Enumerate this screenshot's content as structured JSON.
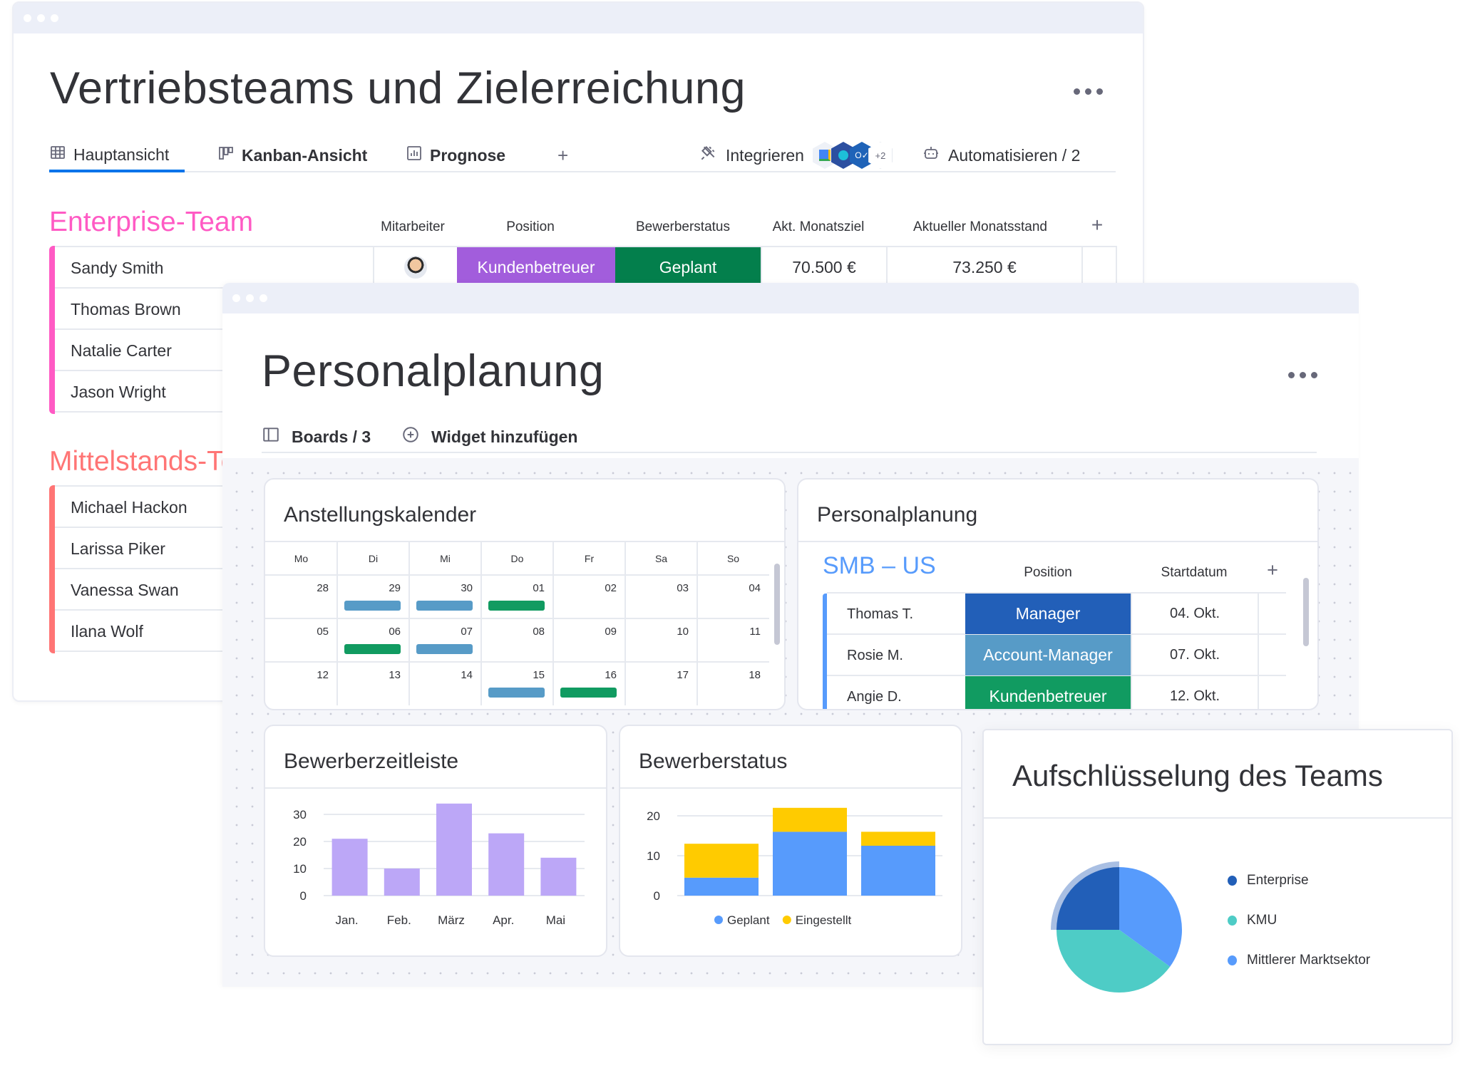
{
  "window1": {
    "title": "Vertriebsteams und Zielerreichung",
    "tabs": [
      {
        "label": "Hauptansicht",
        "icon": "table-icon",
        "active": true
      },
      {
        "label": "Kanban-Ansicht",
        "icon": "kanban-icon",
        "active": false
      },
      {
        "label": "Prognose",
        "icon": "chart-icon",
        "active": false
      }
    ],
    "add_tab_label": "+",
    "integrate_label": "Integrieren",
    "integrations_more": "+2",
    "automate_label": "Automatisieren / 2",
    "columns": [
      "Mitarbeiter",
      "Position",
      "Bewerberstatus",
      "Akt. Monatsziel",
      "Aktueller Monatsstand"
    ],
    "add_column_label": "+",
    "groups": [
      {
        "title": "Enterprise-Team",
        "color": "#ff5ac4",
        "rows": [
          {
            "name": "Sandy Smith",
            "position": "Kundenbetreuer",
            "position_color": "#a25ddc",
            "status": "Geplant",
            "status_color": "#037f4c",
            "goal": "70.500 €",
            "current": "73.250 €"
          },
          {
            "name": "Thomas Brown"
          },
          {
            "name": "Natalie Carter"
          },
          {
            "name": "Jason Wright"
          }
        ]
      },
      {
        "title": "Mittelstands-Team",
        "color": "#ff7575",
        "rows": [
          {
            "name": "Michael Hackon"
          },
          {
            "name": "Larissa Piker"
          },
          {
            "name": "Vanessa Swan"
          },
          {
            "name": "Ilana Wolf"
          }
        ]
      }
    ]
  },
  "window2": {
    "title": "Personalplanung",
    "boards_label": "Boards / 3",
    "add_widget_label": "Widget hinzufügen",
    "calendar": {
      "title": "Anstellungskalender",
      "weekdays": [
        "Mo",
        "Di",
        "Mi",
        "Do",
        "Fr",
        "Sa",
        "So"
      ],
      "weeks": [
        [
          "28",
          "29",
          "30",
          "01",
          "02",
          "03",
          "04"
        ],
        [
          "05",
          "06",
          "07",
          "08",
          "09",
          "10",
          "11"
        ],
        [
          "12",
          "13",
          "14",
          "15",
          "16",
          "17",
          "18"
        ]
      ],
      "events": [
        {
          "week": 0,
          "day": 1,
          "color": "#579bc7"
        },
        {
          "week": 0,
          "day": 2,
          "color": "#579bc7"
        },
        {
          "week": 0,
          "day": 3,
          "color": "#119b61"
        },
        {
          "week": 1,
          "day": 1,
          "color": "#119b61"
        },
        {
          "week": 1,
          "day": 2,
          "color": "#579bc7"
        },
        {
          "week": 2,
          "day": 3,
          "color": "#579bc7"
        },
        {
          "week": 2,
          "day": 4,
          "color": "#119b61"
        }
      ]
    },
    "staffing": {
      "title": "Personalplanung",
      "group_title": "SMB – US",
      "group_color": "#579bfc",
      "columns": [
        "Position",
        "Startdatum"
      ],
      "add_column_label": "+",
      "rows": [
        {
          "name": "Thomas T.",
          "position": "Manager",
          "position_color": "#225fb8",
          "date": "04. Okt."
        },
        {
          "name": "Rosie M.",
          "position": "Account-Manager",
          "position_color": "#579bc7",
          "date": "07. Okt."
        },
        {
          "name": "Angie D.",
          "position": "Kundenbetreuer",
          "position_color": "#119b61",
          "date": "12. Okt."
        }
      ]
    }
  },
  "chart_data": [
    {
      "type": "bar",
      "title": "Bewerberzeitleiste",
      "categories": [
        "Jan.",
        "Feb.",
        "März",
        "Apr.",
        "Mai"
      ],
      "values": [
        21,
        10,
        34,
        23,
        14
      ],
      "yticks": [
        0,
        10,
        20,
        30
      ],
      "ylim": [
        0,
        30
      ],
      "grid": true,
      "color": "#bca7f7",
      "xlabel": "",
      "ylabel": ""
    },
    {
      "type": "bar",
      "stacked": true,
      "title": "Bewerberstatus",
      "categories": [
        "",
        "",
        ""
      ],
      "series": [
        {
          "name": "Geplant",
          "color": "#579bfc",
          "values": [
            4.5,
            16,
            12.5
          ]
        },
        {
          "name": "Eingestellt",
          "color": "#ffcb00",
          "values": [
            8.5,
            6,
            3.5
          ]
        }
      ],
      "yticks": [
        0,
        10,
        20
      ],
      "ylim": [
        0,
        20
      ],
      "grid": true,
      "legend": "bottom"
    },
    {
      "type": "pie",
      "title": "Aufschlüsselung des Teams",
      "slices": [
        {
          "label": "Enterprise",
          "value": 25,
          "color": "#225fb8"
        },
        {
          "label": "Mittlerer Marktsektor",
          "value": 35,
          "color": "#579bfc"
        },
        {
          "label": "KMU",
          "value": 40,
          "color": "#4eccc6"
        }
      ],
      "legend_order": [
        "Enterprise",
        "KMU",
        "Mittlerer Marktsektor"
      ],
      "legend": "right"
    }
  ]
}
